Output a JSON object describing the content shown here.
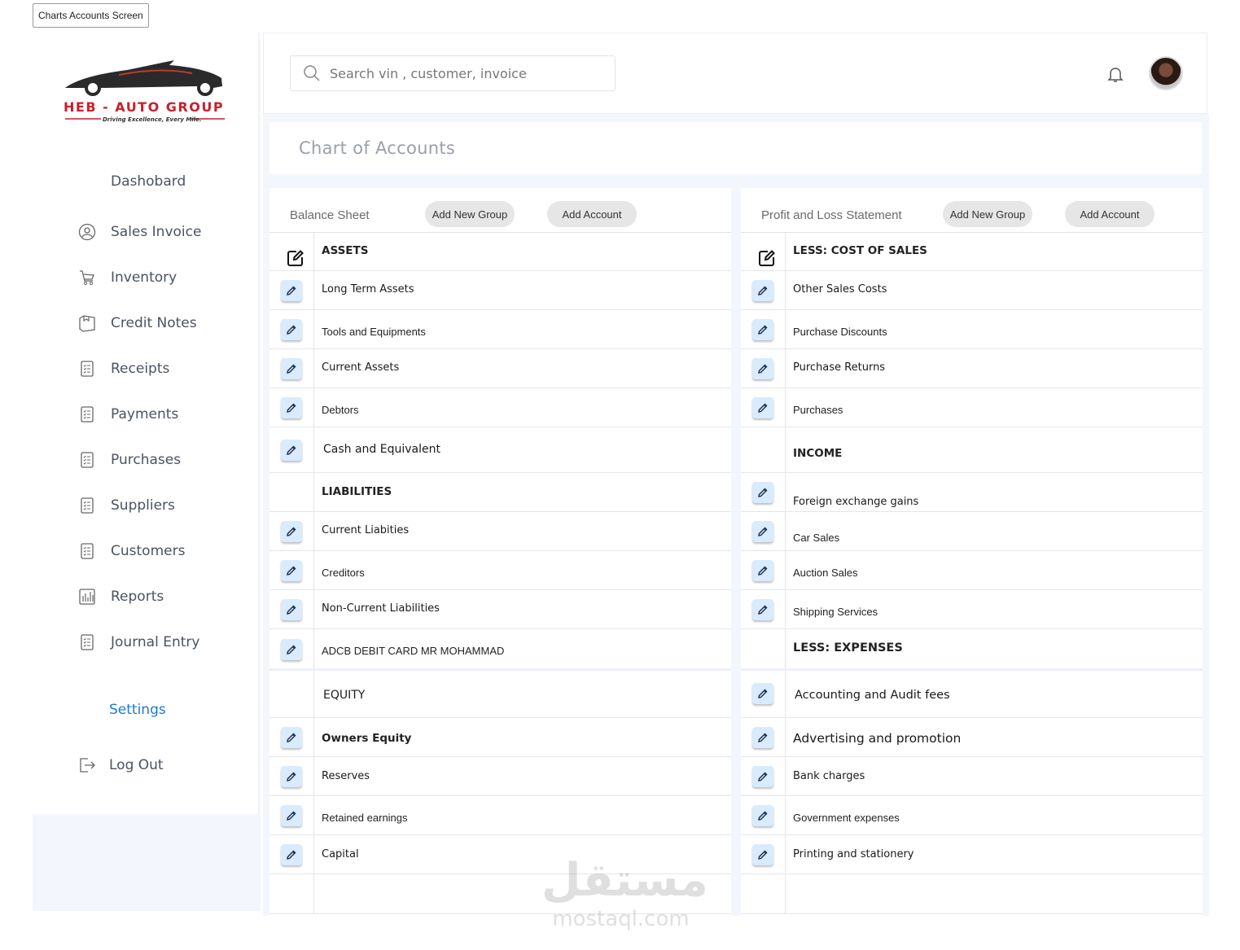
{
  "frame_label": "Charts Accounts Screen",
  "brand": {
    "name": "HEB - AUTO GROUP",
    "tagline": "Driving Excellence, Every Mile."
  },
  "sidebar": {
    "items": [
      {
        "label": "Dashobard",
        "icon": "none"
      },
      {
        "label": "Sales Invoice",
        "icon": "user-circle-icon"
      },
      {
        "label": "Inventory",
        "icon": "cart-icon"
      },
      {
        "label": "Credit Notes",
        "icon": "box-icon"
      },
      {
        "label": "Receipts",
        "icon": "list-doc-icon"
      },
      {
        "label": "Payments",
        "icon": "list-doc-icon"
      },
      {
        "label": "Purchases",
        "icon": "list-doc-icon"
      },
      {
        "label": "Suppliers",
        "icon": "list-doc-icon"
      },
      {
        "label": "Customers",
        "icon": "list-doc-icon"
      },
      {
        "label": "Reports",
        "icon": "bar-chart-icon"
      },
      {
        "label": "Journal Entry",
        "icon": "list-doc-icon"
      }
    ],
    "settings": "Settings",
    "logout": "Log Out"
  },
  "search": {
    "placeholder": "Search vin , customer, invoice"
  },
  "page": {
    "title": "Chart of Accounts"
  },
  "balance_sheet": {
    "title": "Balance Sheet",
    "add_group": "Add New  Group",
    "add_account": "Add Account",
    "rows": [
      {
        "label": "ASSETS"
      },
      {
        "label": "Long Term Assets"
      },
      {
        "label": "Tools and Equipments"
      },
      {
        "label": "Current Assets"
      },
      {
        "label": "Debtors"
      },
      {
        "label": "Cash and Equivalent"
      },
      {
        "label": "LIABILITIES"
      },
      {
        "label": "Current Liabities"
      },
      {
        "label": "Creditors"
      },
      {
        "label": "Non-Current Liabilities"
      },
      {
        "label": "ADCB DEBIT CARD MR MOHAMMAD"
      },
      {
        "label": "EQUITY"
      },
      {
        "label": "Owners Equity"
      },
      {
        "label": "Reserves"
      },
      {
        "label": "Retained earnings"
      },
      {
        "label": "Capital"
      },
      {
        "label": ""
      }
    ]
  },
  "profit_loss": {
    "title": "Profit and Loss Statement",
    "add_group": "Add New  Group",
    "add_account": "Add Account",
    "rows": [
      {
        "label": "LESS:  COST OF SALES"
      },
      {
        "label": "Other Sales Costs"
      },
      {
        "label": "Purchase Discounts"
      },
      {
        "label": "Purchase Returns"
      },
      {
        "label": "Purchases"
      },
      {
        "label": "INCOME"
      },
      {
        "label": "Foreign exchange gains"
      },
      {
        "label": "Car Sales"
      },
      {
        "label": "Auction Sales"
      },
      {
        "label": "Shipping Services"
      },
      {
        "label": "LESS: EXPENSES"
      },
      {
        "label": "Accounting and Audit fees"
      },
      {
        "label": "Advertising and promotion"
      },
      {
        "label": "Bank charges"
      },
      {
        "label": "Government expenses"
      },
      {
        "label": "Printing and stationery"
      },
      {
        "label": ""
      }
    ]
  },
  "watermark": {
    "arabic": "مستقل",
    "latin": "mostaql.com"
  }
}
